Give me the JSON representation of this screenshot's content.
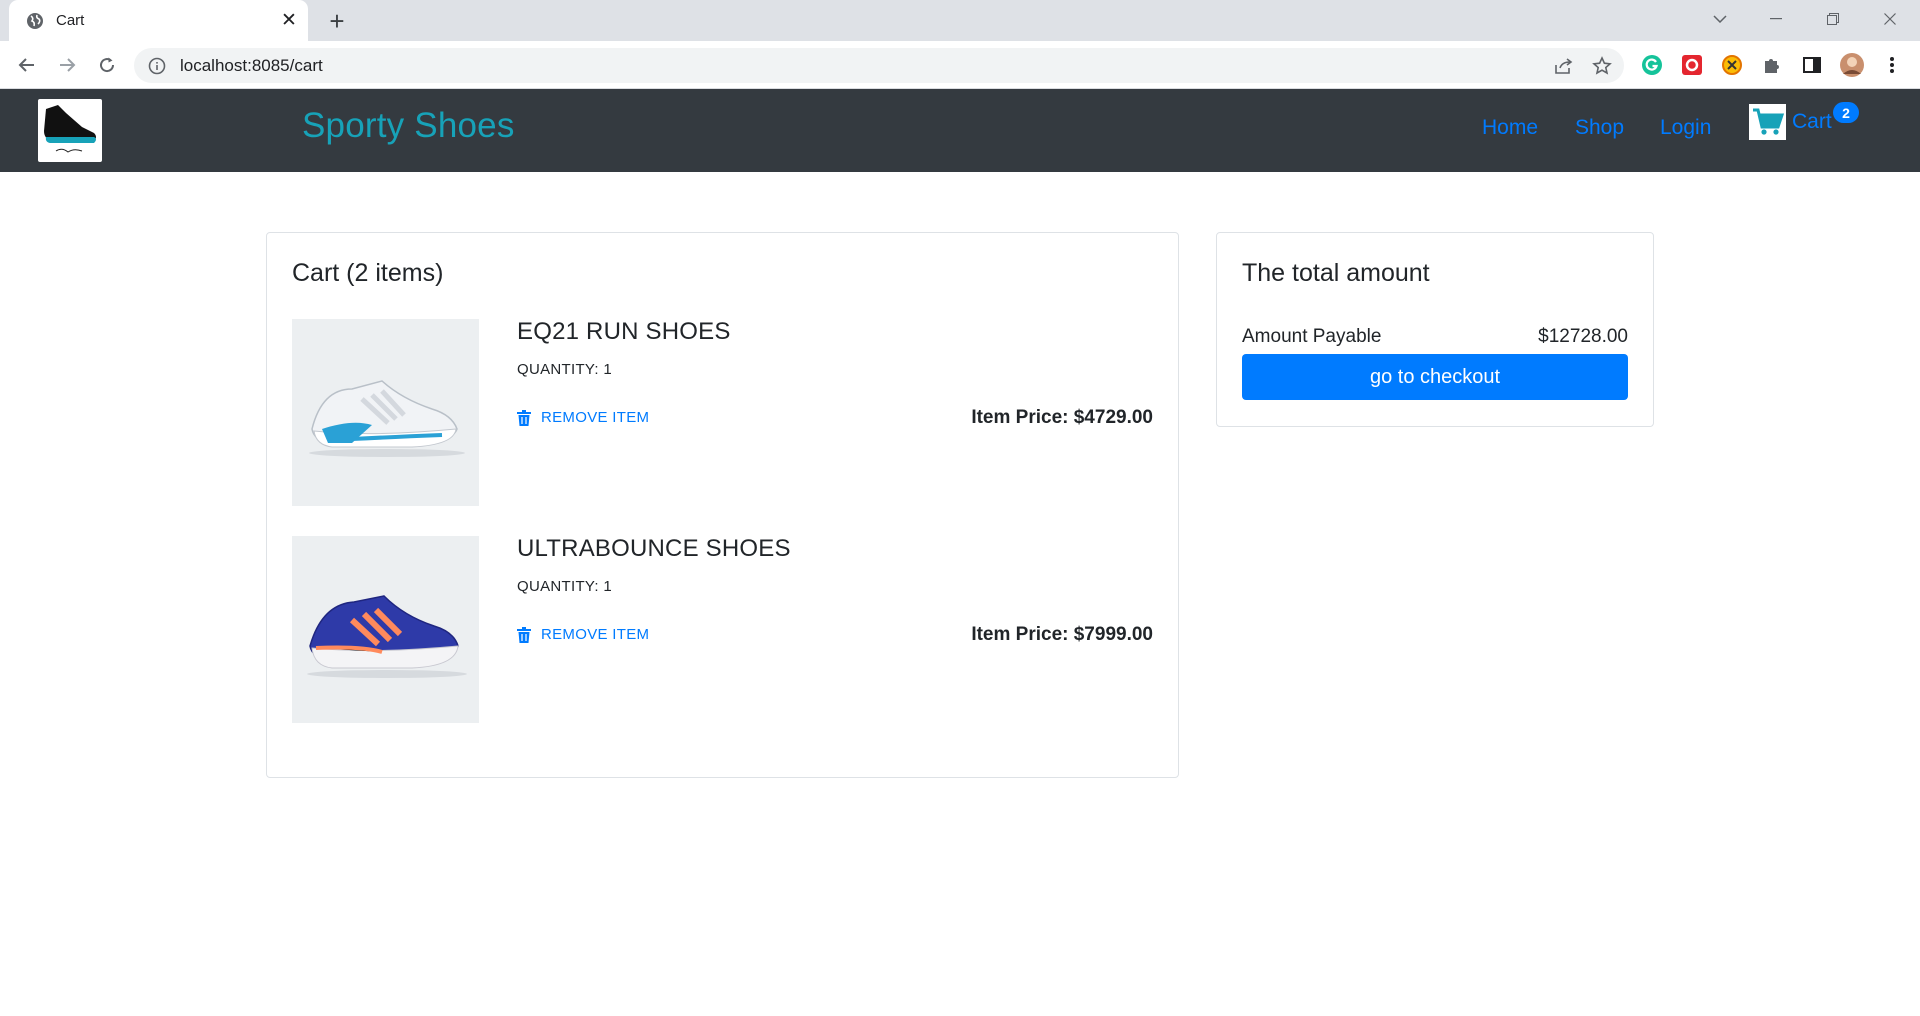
{
  "browser": {
    "tab_title": "Cart",
    "url": "localhost:8085/cart"
  },
  "header": {
    "brand": "Sporty Shoes",
    "nav": [
      "Home",
      "Shop",
      "Login"
    ],
    "cart_label": "Cart",
    "cart_count": "2"
  },
  "cart": {
    "title": "Cart (2 items)",
    "items": [
      {
        "name": "EQ21 RUN SHOES",
        "quantity": "QUANTITY: 1",
        "remove_label": "REMOVE ITEM",
        "price": "Item Price: $4729.00",
        "image_icon": "white-running-shoe"
      },
      {
        "name": "ULTRABOUNCE SHOES",
        "quantity": "QUANTITY: 1",
        "remove_label": "REMOVE ITEM",
        "price": "Item Price: $7999.00",
        "image_icon": "blue-running-shoe"
      }
    ]
  },
  "summary": {
    "title": "The total amount",
    "amount_label": "Amount Payable",
    "amount_value": "$12728.00",
    "checkout_label": "go to checkout"
  },
  "colors": {
    "navbar": "#343a40",
    "brand": "#17a2b8",
    "link": "#007bff",
    "cart_icon": "#17a2b8"
  }
}
